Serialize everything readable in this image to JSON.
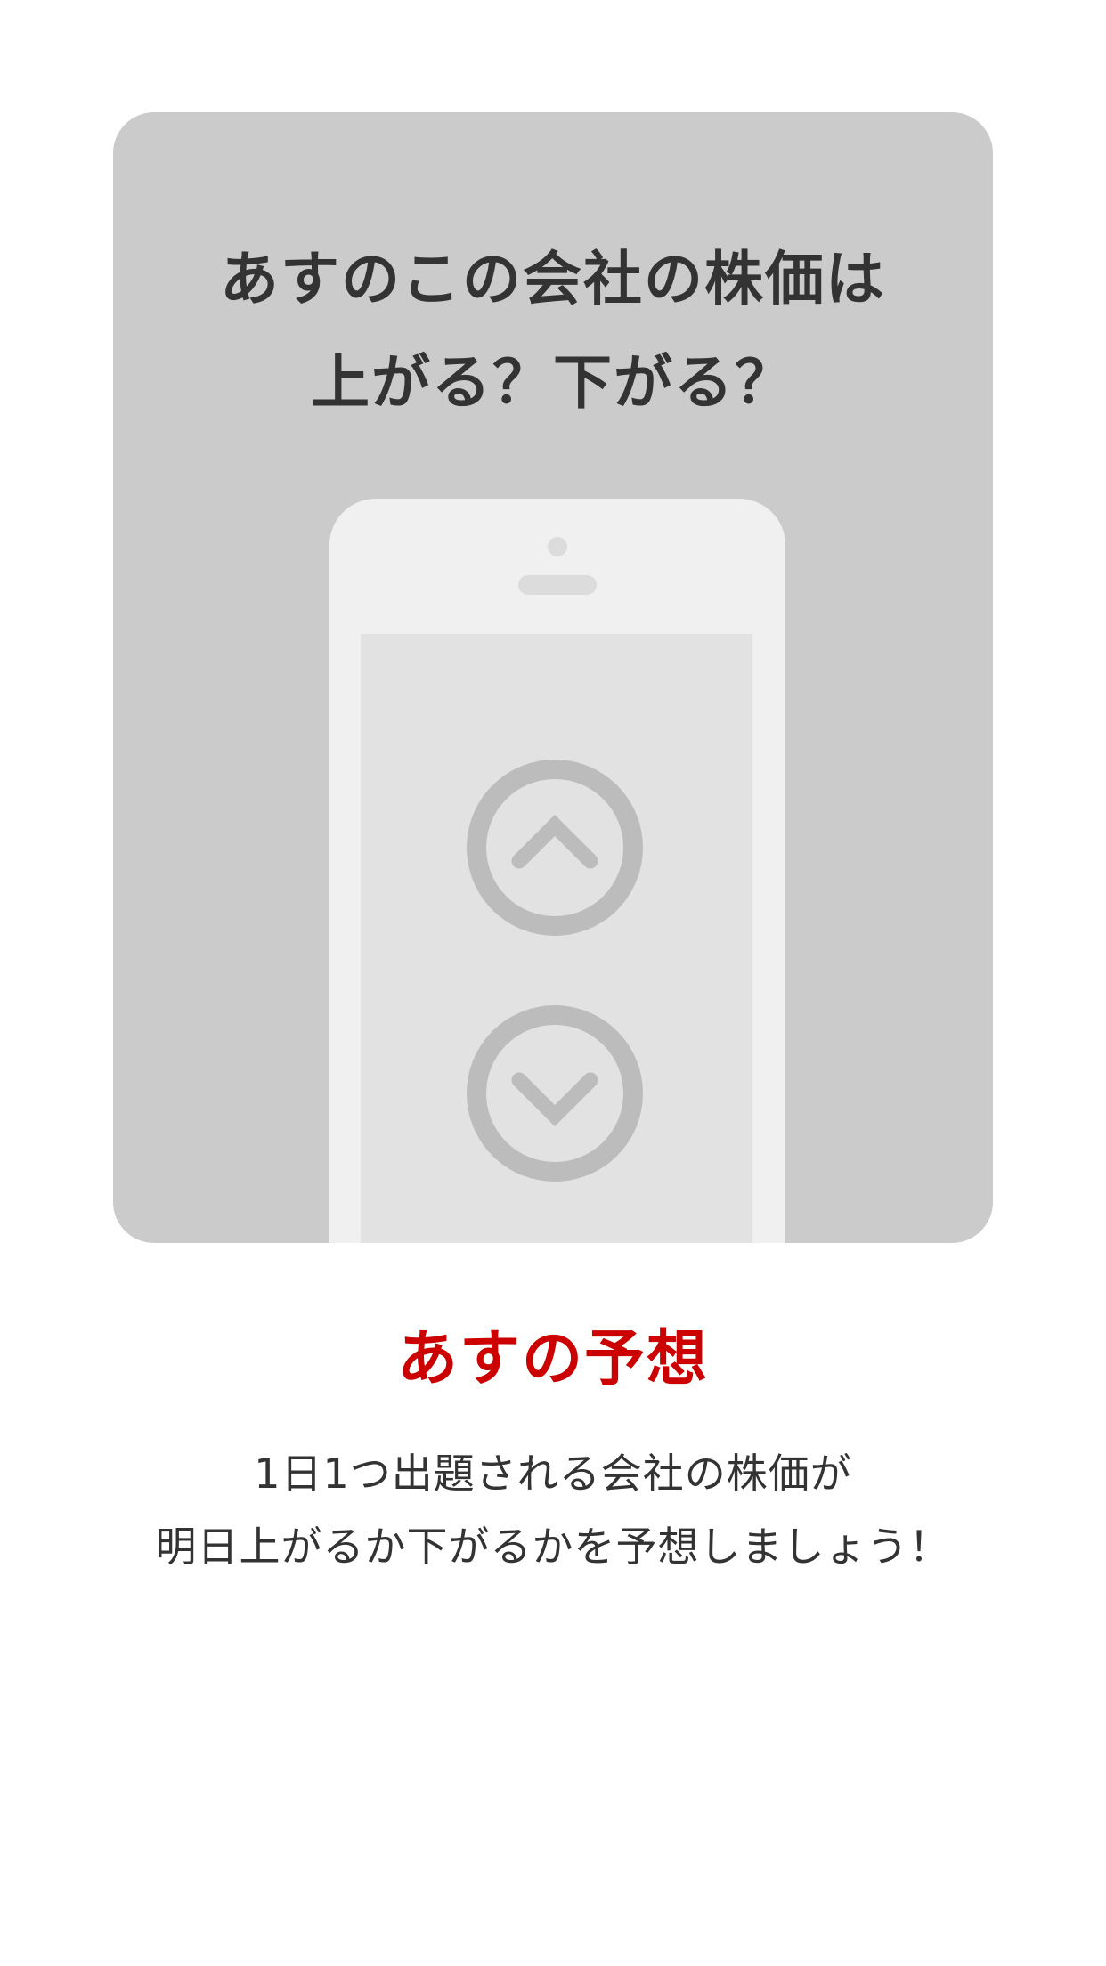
{
  "hero": {
    "title_line1": "あすのこの会社の株価は",
    "title_line2": "上がる？下がる？",
    "up_icon": "chevron-up-circle-icon",
    "down_icon": "chevron-down-circle-icon"
  },
  "feature": {
    "title": "あすの予想",
    "description_line1": "1日1つ出題される会社の株価が",
    "description_line2": "明日上がるか下がるかを予想しましょう！"
  },
  "colors": {
    "background": "#ffffff",
    "card": "#cbcbcb",
    "phone_body": "#f0f0f0",
    "phone_screen": "#e2e2e2",
    "icon": "#bcbcbc",
    "accent": "#cc0000",
    "text": "#333333"
  }
}
